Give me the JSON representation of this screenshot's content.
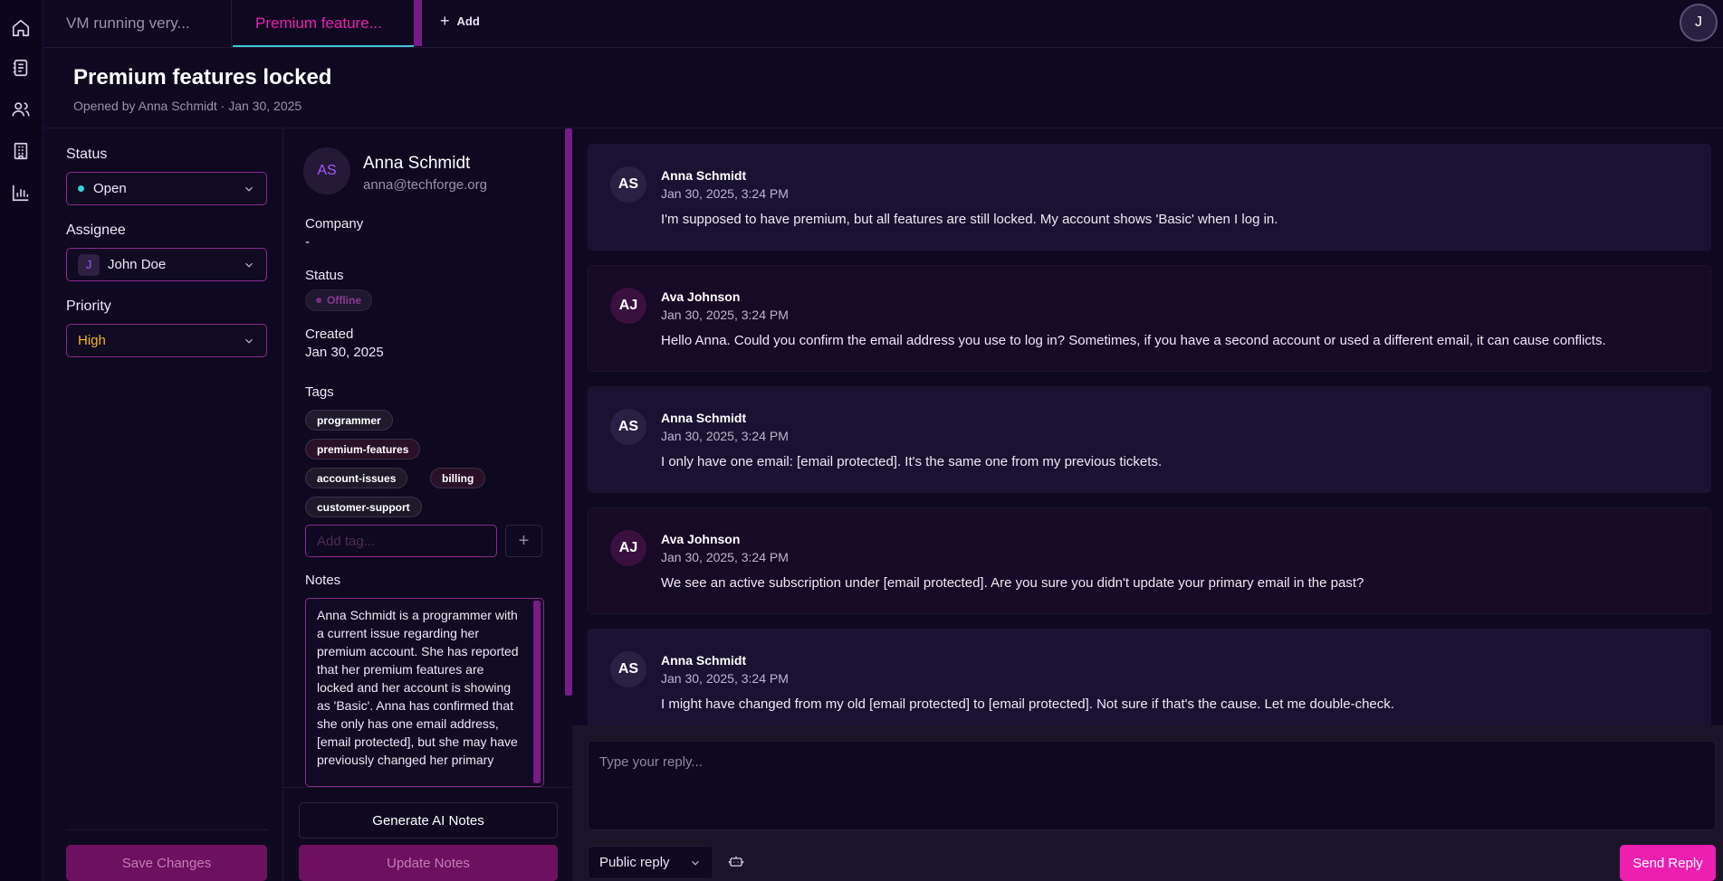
{
  "nav": {
    "items": [
      {
        "name": "home-icon"
      },
      {
        "name": "tickets-icon"
      },
      {
        "name": "users-icon"
      },
      {
        "name": "building-icon"
      },
      {
        "name": "chart-icon"
      }
    ]
  },
  "tabs": [
    {
      "label": "VM running very...",
      "active": false
    },
    {
      "label": "Premium feature...",
      "active": true
    }
  ],
  "add_tab_label": "Add",
  "user_initial": "J",
  "ticket": {
    "title": "Premium features locked",
    "subtitle": "Opened by Anna Schmidt · Jan 30, 2025"
  },
  "properties": {
    "status_label": "Status",
    "status_value": "Open",
    "assignee_label": "Assignee",
    "assignee_initial": "J",
    "assignee_value": "John Doe",
    "priority_label": "Priority",
    "priority_value": "High",
    "save_label": "Save Changes"
  },
  "contact": {
    "initials": "AS",
    "name": "Anna Schmidt",
    "email": "anna@techforge.org",
    "company_label": "Company",
    "company_value": "-",
    "status_label": "Status",
    "status_value": "Offline",
    "created_label": "Created",
    "created_value": "Jan 30, 2025",
    "tags_label": "Tags",
    "tags": [
      "programmer",
      "premium-features",
      "account-issues",
      "billing",
      "customer-support"
    ],
    "tag_placeholder": "Add tag...",
    "notes_label": "Notes",
    "notes_text": "Anna Schmidt is a programmer with a current issue regarding her premium account. She has reported that her premium features are locked and her account is showing as 'Basic'. Anna has confirmed that she only has one email address, [email protected], but she may have previously changed her primary",
    "generate_label": "Generate AI Notes",
    "update_label": "Update Notes"
  },
  "messages": [
    {
      "initials": "AS",
      "author": "Anna Schmidt",
      "time": "Jan 30, 2025, 3:24 PM",
      "role": "customer",
      "body": "I'm supposed to have premium, but all features are still locked. My account shows 'Basic' when I log in."
    },
    {
      "initials": "AJ",
      "author": "Ava Johnson",
      "time": "Jan 30, 2025, 3:24 PM",
      "role": "agent",
      "body": "Hello Anna. Could you confirm the email address you use to log in? Sometimes, if you have a second account or used a different email, it can cause conflicts."
    },
    {
      "initials": "AS",
      "author": "Anna Schmidt",
      "time": "Jan 30, 2025, 3:24 PM",
      "role": "customer",
      "body": "I only have one email: [email protected]. It's the same one from my previous tickets."
    },
    {
      "initials": "AJ",
      "author": "Ava Johnson",
      "time": "Jan 30, 2025, 3:24 PM",
      "role": "agent",
      "body": "We see an active subscription under [email protected]. Are you sure you didn't update your primary email in the past?"
    },
    {
      "initials": "AS",
      "author": "Anna Schmidt",
      "time": "Jan 30, 2025, 3:24 PM",
      "role": "customer",
      "body": "I might have changed from my old [email protected] to [email protected]. Not sure if that's the cause. Let me double-check."
    }
  ],
  "composer": {
    "placeholder": "Type your reply...",
    "reply_type": "Public reply",
    "send_label": "Send Reply"
  }
}
